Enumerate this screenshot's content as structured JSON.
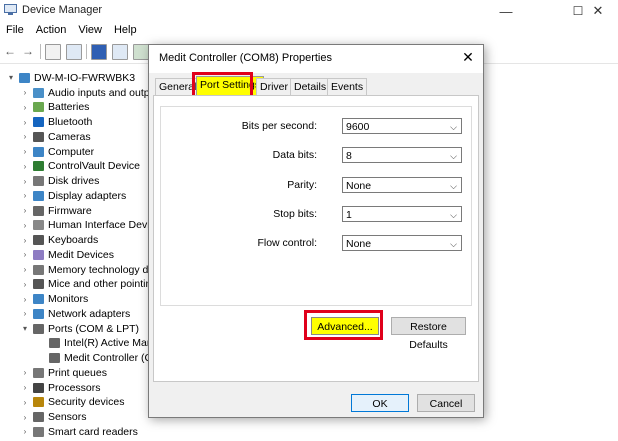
{
  "window": {
    "title": "Device Manager",
    "controls": {
      "minimize": "—",
      "maximize": "☐",
      "close": "✕"
    }
  },
  "menu": [
    "File",
    "Action",
    "View",
    "Help"
  ],
  "tree": {
    "root": "DW-M-IO-FWRWBK3",
    "items": [
      {
        "label": "Audio inputs and outp",
        "color": "#4a90c8"
      },
      {
        "label": "Batteries",
        "color": "#6aa84f"
      },
      {
        "label": "Bluetooth",
        "color": "#1565c0"
      },
      {
        "label": "Cameras",
        "color": "#555555"
      },
      {
        "label": "Computer",
        "color": "#3d85c6"
      },
      {
        "label": "ControlVault Device",
        "color": "#2e7d32"
      },
      {
        "label": "Disk drives",
        "color": "#777777"
      },
      {
        "label": "Display adapters",
        "color": "#3d85c6"
      },
      {
        "label": "Firmware",
        "color": "#666666"
      },
      {
        "label": "Human Interface Devic",
        "color": "#888888"
      },
      {
        "label": "Keyboards",
        "color": "#555555"
      },
      {
        "label": "Medit Devices",
        "color": "#8e7cc3"
      },
      {
        "label": "Memory technology d",
        "color": "#777777"
      },
      {
        "label": "Mice and other pointin",
        "color": "#555555"
      },
      {
        "label": "Monitors",
        "color": "#3d85c6"
      },
      {
        "label": "Network adapters",
        "color": "#3d85c6"
      },
      {
        "label": "Ports (COM & LPT)",
        "color": "#666666"
      },
      {
        "label": "Intel(R) Active Mar",
        "color": "#666666"
      },
      {
        "label": "Medit Controller (C",
        "color": "#666666"
      },
      {
        "label": "Print queues",
        "color": "#777777"
      },
      {
        "label": "Processors",
        "color": "#444444"
      },
      {
        "label": "Security devices",
        "color": "#b8860b"
      },
      {
        "label": "Sensors",
        "color": "#666666"
      },
      {
        "label": "Smart card readers",
        "color": "#777777"
      }
    ]
  },
  "dialog": {
    "title": "Medit Controller (COM8) Properties",
    "close": "✕",
    "tabs": [
      "General",
      "Port Settings",
      "Driver",
      "Details",
      "Events"
    ],
    "active_tab": "Port Settings",
    "fields": [
      {
        "label": "Bits per second:",
        "value": "9600"
      },
      {
        "label": "Data bits:",
        "value": "8"
      },
      {
        "label": "Parity:",
        "value": "None"
      },
      {
        "label": "Stop bits:",
        "value": "1"
      },
      {
        "label": "Flow control:",
        "value": "None"
      }
    ],
    "advanced_label": "Advanced...",
    "restore_label": "Restore Defaults",
    "ok_label": "OK",
    "cancel_label": "Cancel"
  },
  "colors": {
    "highlight": "#ffff00",
    "annotation": "#e0001b"
  }
}
